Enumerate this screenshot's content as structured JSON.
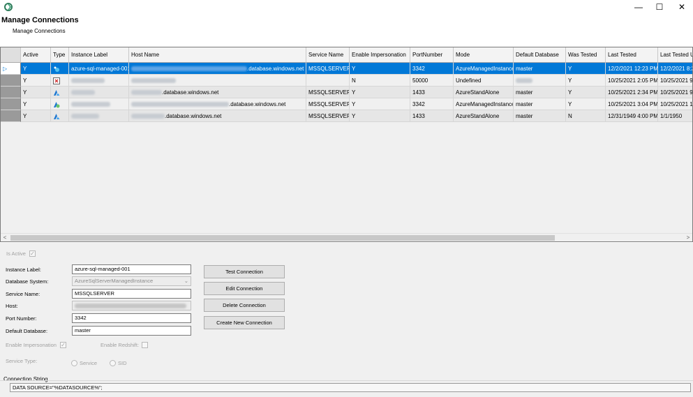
{
  "window": {
    "minimize_glyph": "—",
    "maximize_glyph": "☐",
    "close_glyph": "✕"
  },
  "page": {
    "title": "Manage Connections",
    "subtitle": "Manage Connections"
  },
  "grid": {
    "columns": [
      "Active",
      "Type",
      "Instance Label",
      "Host Name",
      "Service Name",
      "Enable Impersonation",
      "PortNumber",
      "Mode",
      "Default Database",
      "Was Tested",
      "Last Tested",
      "Last Tested U"
    ],
    "rows": [
      {
        "indicator": "▷",
        "active": "Y",
        "type_icon": "azure-managed-instance-icon",
        "instance_label": "azure-sql-managed-001",
        "host_suffix": ".database.windows.net",
        "service_name": "MSSQLSERVER",
        "enable_impersonation": "Y",
        "port": "3342",
        "mode": "AzureManagedInstance",
        "default_database": "master",
        "was_tested": "Y",
        "last_tested": "12/2/2021 12:23 PM",
        "last_tested_u": "12/2/2021 8:2"
      },
      {
        "indicator": "",
        "active": "Y",
        "type_icon": "broken-image-icon",
        "instance_label": "",
        "host_suffix": "",
        "service_name": "",
        "enable_impersonation": "N",
        "port": "50000",
        "mode": "Undefined",
        "default_database": "",
        "was_tested": "Y",
        "last_tested": "10/25/2021 2:05 PM",
        "last_tested_u": "10/25/2021 9:"
      },
      {
        "indicator": "",
        "active": "Y",
        "type_icon": "azure-icon",
        "instance_label": "",
        "host_suffix": ".database.windows.net",
        "service_name": "MSSQLSERVER",
        "enable_impersonation": "Y",
        "port": "1433",
        "mode": "AzureStandAlone",
        "default_database": "master",
        "was_tested": "Y",
        "last_tested": "10/25/2021 2:34 PM",
        "last_tested_u": "10/25/2021 9:"
      },
      {
        "indicator": "",
        "active": "Y",
        "type_icon": "azure-managed-icon",
        "instance_label": "",
        "host_suffix": ".database.windows.net",
        "service_name": "MSSQLSERVER",
        "enable_impersonation": "Y",
        "port": "3342",
        "mode": "AzureManagedInstance",
        "default_database": "master",
        "was_tested": "Y",
        "last_tested": "10/25/2021 3:04 PM",
        "last_tested_u": "10/25/2021 10"
      },
      {
        "indicator": "",
        "active": "Y",
        "type_icon": "azure-icon",
        "instance_label": "",
        "host_suffix": ".database.windows.net",
        "service_name": "MSSQLSERVER",
        "enable_impersonation": "Y",
        "port": "1433",
        "mode": "AzureStandAlone",
        "default_database": "master",
        "was_tested": "N",
        "last_tested": "12/31/1949 4:00 PM",
        "last_tested_u": "1/1/1950"
      }
    ],
    "scroll_left": "<",
    "scroll_right": ">"
  },
  "form": {
    "is_active_label": "Is Active",
    "instance_label_label": "Instance Label:",
    "instance_label_value": "azure-sql-managed-001",
    "database_system_label": "Database System:",
    "database_system_value": "AzureSqlServerManagedInstance",
    "service_name_label": "Service Name:",
    "service_name_value": "MSSQLSERVER",
    "host_label": "Host:",
    "port_label": "Port Number:",
    "port_value": "3342",
    "default_db_label": "Default Database:",
    "default_db_value": "master",
    "enable_impersonation_label": "Enable Impersonation",
    "enable_redshift_label": "Enable Redshift:",
    "service_type_label": "Service Type:",
    "radio_service": "Service",
    "radio_sid": "SID",
    "check_glyph": "✓",
    "dropdown_glyph": "⌄"
  },
  "buttons": {
    "test": "Test Connection",
    "edit": "Edit Connection",
    "delete": "Delete Connection",
    "create": "Create New Connection"
  },
  "connection_string": {
    "label": "Connection String",
    "value": "DATA SOURCE=\"%DATASOURCE%\";"
  }
}
